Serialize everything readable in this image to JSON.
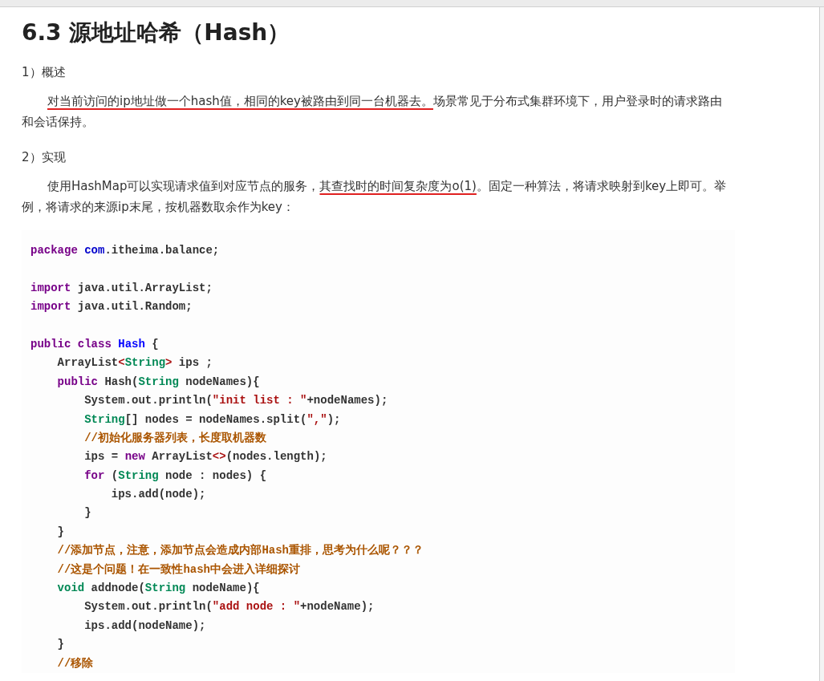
{
  "heading": "6.3 源地址哈希（Hash）",
  "sections": [
    {
      "title": "1）概述",
      "paragraphs": [
        [
          {
            "text": "对当前访问的ip地址做一个hash值，相同的key被路由到同一台机器去。",
            "underlined": true
          },
          {
            "text": "场景常见于分布式集群环境下，用户登录时的请求路由和会话保持。",
            "underlined": false
          }
        ]
      ]
    },
    {
      "title": "2）实现",
      "paragraphs": [
        [
          {
            "text": "使用HashMap可以实现请求值到对应节点的服务，",
            "underlined": false
          },
          {
            "text": "其查找时的时间复杂度为o(1)",
            "underlined": true
          },
          {
            "text": "。固定一种算法，将请求映射到key上即可。举例，将请求的来源ip末尾，按机器数取余作为key：",
            "underlined": false
          }
        ]
      ]
    }
  ],
  "code_blocks": [
    [
      {
        "tokens": [
          {
            "kind": "kw",
            "text": "package"
          },
          {
            "kind": "var",
            "text": " com"
          },
          {
            "kind": "plain",
            "text": ".itheima.balance;"
          }
        ]
      }
    ],
    [
      {
        "tokens": [
          {
            "kind": "kw",
            "text": "import"
          },
          {
            "kind": "plain",
            "text": " java.util.ArrayList;"
          }
        ]
      },
      {
        "tokens": [
          {
            "kind": "kw",
            "text": "import"
          },
          {
            "kind": "plain",
            "text": " java.util.Random;"
          }
        ]
      }
    ],
    [
      {
        "tokens": [
          {
            "kind": "kw",
            "text": "public class"
          },
          {
            "kind": "def",
            "text": " Hash"
          },
          {
            "kind": "plain",
            "text": " {"
          }
        ]
      },
      {
        "tokens": [
          {
            "kind": "plain",
            "text": "    ArrayList"
          },
          {
            "kind": "str",
            "text": "<"
          },
          {
            "kind": "type",
            "text": "String"
          },
          {
            "kind": "str",
            "text": ">"
          },
          {
            "kind": "plain",
            "text": " ips ;"
          }
        ]
      },
      {
        "tokens": [
          {
            "kind": "kw",
            "text": "    public"
          },
          {
            "kind": "plain",
            "text": " Hash("
          },
          {
            "kind": "type",
            "text": "String"
          },
          {
            "kind": "plain",
            "text": " nodeNames){"
          }
        ]
      },
      {
        "tokens": [
          {
            "kind": "plain",
            "text": "        System.out.println("
          },
          {
            "kind": "str",
            "text": "\"init list : \""
          },
          {
            "kind": "plain",
            "text": "+nodeNames);"
          }
        ]
      },
      {
        "tokens": [
          {
            "kind": "type",
            "text": "        String"
          },
          {
            "kind": "plain",
            "text": "[] nodes = nodeNames.split("
          },
          {
            "kind": "str",
            "text": "\",\""
          },
          {
            "kind": "plain",
            "text": ");"
          }
        ]
      },
      {
        "tokens": [
          {
            "kind": "comment",
            "text": "        //初始化服务器列表，长度取机器数"
          }
        ]
      },
      {
        "tokens": [
          {
            "kind": "plain",
            "text": "        ips = "
          },
          {
            "kind": "kw",
            "text": "new"
          },
          {
            "kind": "plain",
            "text": " ArrayList"
          },
          {
            "kind": "str",
            "text": "<>"
          },
          {
            "kind": "plain",
            "text": "(nodes.length);"
          }
        ]
      },
      {
        "tokens": [
          {
            "kind": "kw",
            "text": "        for"
          },
          {
            "kind": "plain",
            "text": " ("
          },
          {
            "kind": "type",
            "text": "String"
          },
          {
            "kind": "plain",
            "text": " node : nodes) {"
          }
        ]
      },
      {
        "tokens": [
          {
            "kind": "plain",
            "text": "            ips.add(node);"
          }
        ]
      },
      {
        "tokens": [
          {
            "kind": "plain",
            "text": "        }"
          }
        ]
      },
      {
        "tokens": [
          {
            "kind": "plain",
            "text": "    }"
          }
        ]
      },
      {
        "tokens": [
          {
            "kind": "comment",
            "text": "    //添加节点，注意，添加节点会造成内部Hash重排，思考为什么呢？？？"
          }
        ]
      },
      {
        "tokens": [
          {
            "kind": "comment",
            "text": "    //这是个问题！在一致性hash中会进入详细探讨"
          }
        ]
      },
      {
        "tokens": [
          {
            "kind": "type",
            "text": "    void"
          },
          {
            "kind": "plain",
            "text": " addnode("
          },
          {
            "kind": "type",
            "text": "String"
          },
          {
            "kind": "plain",
            "text": " nodeName){"
          }
        ]
      },
      {
        "tokens": [
          {
            "kind": "plain",
            "text": "        System.out.println("
          },
          {
            "kind": "str",
            "text": "\"add node : \""
          },
          {
            "kind": "plain",
            "text": "+nodeName);"
          }
        ]
      },
      {
        "tokens": [
          {
            "kind": "plain",
            "text": "        ips.add(nodeName);"
          }
        ]
      },
      {
        "tokens": [
          {
            "kind": "plain",
            "text": "    }"
          }
        ]
      },
      {
        "tokens": [
          {
            "kind": "comment",
            "text": "    //移除"
          }
        ]
      }
    ]
  ]
}
